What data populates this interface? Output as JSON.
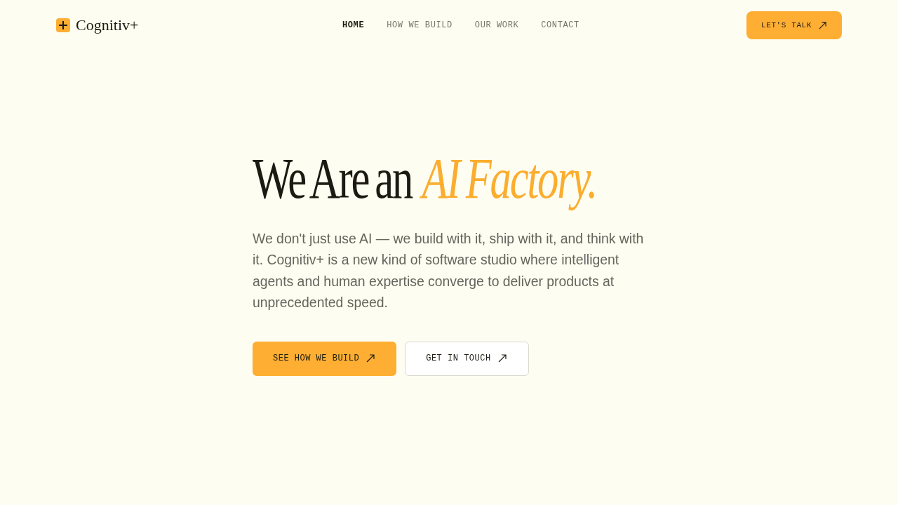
{
  "header": {
    "logo": {
      "text": "Cognitiv+"
    },
    "nav": [
      {
        "label": "HOME",
        "selected": true
      },
      {
        "label": "HOW WE BUILD",
        "selected": false
      },
      {
        "label": "OUR WORK",
        "selected": false
      },
      {
        "label": "CONTACT",
        "selected": false
      }
    ],
    "cta": {
      "label": "LET'S TALK"
    }
  },
  "hero": {
    "heading": "We Are an *AI Factory.*",
    "description": "We don't just use AI — we build with it, ship with it, and think with it. Cognitiv+ is a new kind of software studio where intelligent agents and human expertise converge to deliver products at unprecedented speed.",
    "buttons": [
      {
        "label": "SEE HOW WE BUILD",
        "kind": "primary"
      },
      {
        "label": "GET IN TOUCH",
        "kind": "secondary"
      }
    ]
  }
}
